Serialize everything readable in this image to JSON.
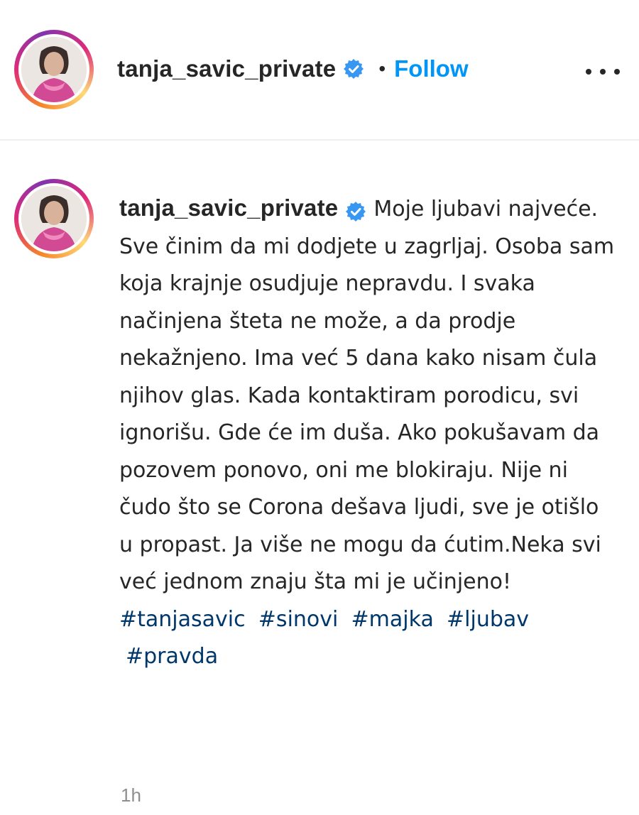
{
  "header": {
    "username": "tanja_savic_private",
    "separator": "•",
    "follow_label": "Follow"
  },
  "post": {
    "username": "tanja_savic_private",
    "caption": "Moje ljubavi najveće. Sve činim da mi dodjete u zagrljaj. Osoba sam koja krajnje osudjuje nepravdu. I svaka načinjena šteta ne može, a da prodje nekažnjeno. Ima već 5 dana kako nisam čula njihov glas. Kada kontaktiram porodicu, svi ignorišu. Gde će im duša. Ako pokušavam da pozovem ponovo, oni me blokiraju. Nije ni čudo što se Corona dešava ljudi, sve je otišlo u propast. Ja više ne mogu da ćutim.Neka svi već jednom znaju šta mi je učinjeno!",
    "hashtags": [
      "#tanjasavic",
      "#sinovi",
      "#majka",
      "#ljubav",
      "#pravda"
    ],
    "time": "1h"
  },
  "colors": {
    "follow": "#0095f6",
    "hashtag": "#00376b",
    "verified": "#3897f0",
    "muted": "#8e8e8e"
  },
  "icons": {
    "verified": "verified-badge-icon",
    "more": "more-options-icon"
  }
}
